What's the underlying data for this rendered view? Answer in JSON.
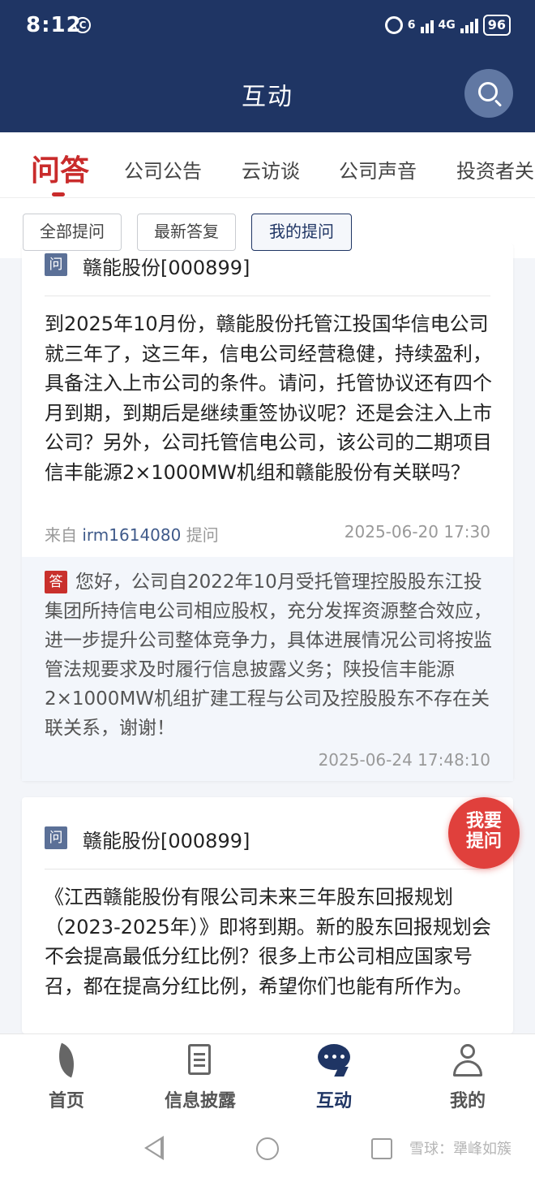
{
  "status_bar": {
    "time": "8:12",
    "time_badge": "C",
    "network_wifi": "6",
    "network_cell": "4G",
    "battery": "96"
  },
  "header": {
    "title": "互动"
  },
  "tabs": [
    "问答",
    "公司公告",
    "云访谈",
    "公司声音",
    "投资者关系"
  ],
  "filters": [
    "全部提问",
    "最新答复",
    "我的提问"
  ],
  "qa": [
    {
      "q_tag": "问",
      "company": "赣能股份[000899]",
      "question": "到2025年10月份，赣能股份托管江投国华信电公司就三年了，这三年，信电公司经营稳健，持续盈利，具备注入上市公司的条件。请问，托管协议还有四个月到期，到期后是继续重签协议呢？还是会注入上市公司？另外，公司托管信电公司，该公司的二期项目信丰能源2×1000MW机组和赣能股份有关联吗？",
      "from_prefix": "来自",
      "user_id": "irm1614080",
      "from_suffix": "提问",
      "q_time": "2025-06-20 17:30",
      "a_tag": "答",
      "answer": "您好，公司自2022年10月受托管理控股股东江投集团所持信电公司相应股权，充分发挥资源整合效应，进一步提升公司整体竞争力，具体进展情况公司将按监管法规要求及时履行信息披露义务；陕投信丰能源 2×1000MW机组扩建工程与公司及控股股东不存在关联关系，谢谢！",
      "a_time": "2025-06-24 17:48:10"
    },
    {
      "q_tag": "问",
      "company": "赣能股份[000899]",
      "question": "《江西赣能股份有限公司未来三年股东回报规划（2023-2025年）》即将到期。新的股东回报规划会不会提高最低分红比例？很多上市公司相应国家号召，都在提高分红比例，希望你们也能有所作为。"
    }
  ],
  "fab": {
    "line1": "我要",
    "line2": "提问"
  },
  "bottom_nav": [
    "首页",
    "信息披露",
    "互动",
    "我的"
  ],
  "watermark": "雪球：犟峰如簇"
}
